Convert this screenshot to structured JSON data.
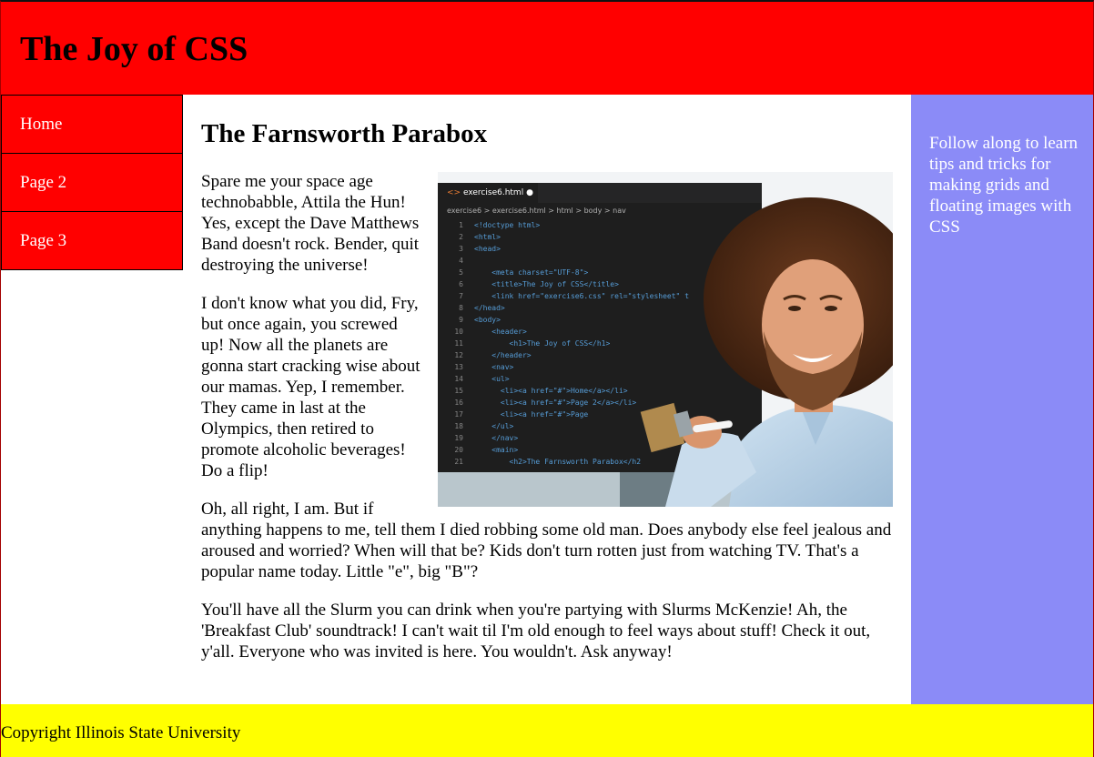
{
  "header": {
    "title": "The Joy of CSS"
  },
  "nav": {
    "items": [
      {
        "label": "Home"
      },
      {
        "label": "Page 2"
      },
      {
        "label": "Page 3"
      }
    ]
  },
  "main": {
    "heading": "The Farnsworth Parabox",
    "paragraphs": [
      "Spare me your space age technobabble, Attila the Hun! Yes, except the Dave Matthews Band doesn't rock. Bender, quit destroying the universe!",
      "I don't know what you did, Fry, but once again, you screwed up! Now all the planets are gonna start cracking wise about our mamas. Yep, I remember. They came in last at the Olympics, then retired to promote alcoholic beverages! Do a flip!",
      "Oh, all right, I am. But if anything happens to me, tell them I died robbing some old man. Does anybody else feel jealous and aroused and worried? When will that be? Kids don't turn rotten just from watching TV. That's a popular name today. Little \"e\", big \"B\"?",
      "You'll have all the Slurm you can drink when you're partying with Slurms McKenzie! Ah, the 'Breakfast Club' soundtrack! I can't wait til I'm old enough to feel ways about stuff! Check it out, y'all. Everyone who was invited is here. You wouldn't. Ask anyway!"
    ],
    "image": {
      "editor_tab": "exercise6.html",
      "breadcrumb": "exercise6 > exercise6.html > html > body > nav",
      "code_lines": [
        [
          "1",
          "<!doctype html>"
        ],
        [
          "2",
          "<html>"
        ],
        [
          "3",
          "<head>"
        ],
        [
          "4",
          ""
        ],
        [
          "5",
          "    <meta charset=\"UTF-8\">"
        ],
        [
          "6",
          "    <title>The Joy of CSS</title>"
        ],
        [
          "7",
          "    <link href=\"exercise6.css\" rel=\"stylesheet\" t"
        ],
        [
          "8",
          "</head>"
        ],
        [
          "9",
          "<body>"
        ],
        [
          "10",
          "    <header>"
        ],
        [
          "11",
          "        <h1>The Joy of CSS</h1>"
        ],
        [
          "12",
          "    </header>"
        ],
        [
          "13",
          "    <nav>"
        ],
        [
          "14",
          "    <ul>"
        ],
        [
          "15",
          "      <li><a href=\"#\">Home</a></li>"
        ],
        [
          "16",
          "      <li><a href=\"#\">Page 2</a></li>"
        ],
        [
          "17",
          "      <li><a href=\"#\">Page"
        ],
        [
          "18",
          "    </ul>"
        ],
        [
          "19",
          "    </nav>"
        ],
        [
          "20",
          "    <main>"
        ],
        [
          "21",
          "        <h2>The Farnsworth Parabox</h2"
        ]
      ]
    }
  },
  "aside": {
    "text": "Follow along to learn tips and tricks for making grids and floating images with CSS"
  },
  "footer": {
    "text": "Copyright Illinois State University"
  },
  "colors": {
    "header_bg": "#ff0000",
    "nav_bg": "#ff0000",
    "aside_bg": "#8b8bf7",
    "footer_bg": "#ffff00"
  }
}
